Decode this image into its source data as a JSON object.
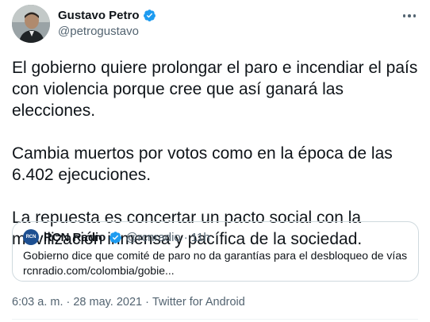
{
  "author": {
    "display_name": "Gustavo Petro",
    "handle": "@petrogustavo"
  },
  "tweet": {
    "paragraphs": [
      "El gobierno quiere prolongar el paro e incendiar el país con violencia porque cree que así ganará las elecciones.",
      "Cambia muertos por votos como en la época de las 6.402 ejecuciones.",
      "La repuesta es concertar un pacto social con la movilización inmensa y pacífica de la sociedad."
    ]
  },
  "quoted": {
    "logo_text": "RCN",
    "display_name": "RCN Radio",
    "handle": "@rcnradio",
    "separator": "·",
    "time": "11h",
    "text_line1": "Gobierno dice que comité de paro no da garantías para el desbloqueo de vías",
    "text_line2": "rcnradio.com/colombia/gobie..."
  },
  "footer": {
    "time": "6:03 a. m.",
    "separator1": "·",
    "date": "28 may. 2021",
    "separator2": "·",
    "source": "Twitter for Android"
  },
  "colors": {
    "verified": "#1d9bf0",
    "secondary_text": "#536471",
    "primary_text": "#0f1419",
    "border": "#cfd9de"
  },
  "icons": {
    "verified": "verified-badge-icon",
    "more": "more-options-icon"
  }
}
